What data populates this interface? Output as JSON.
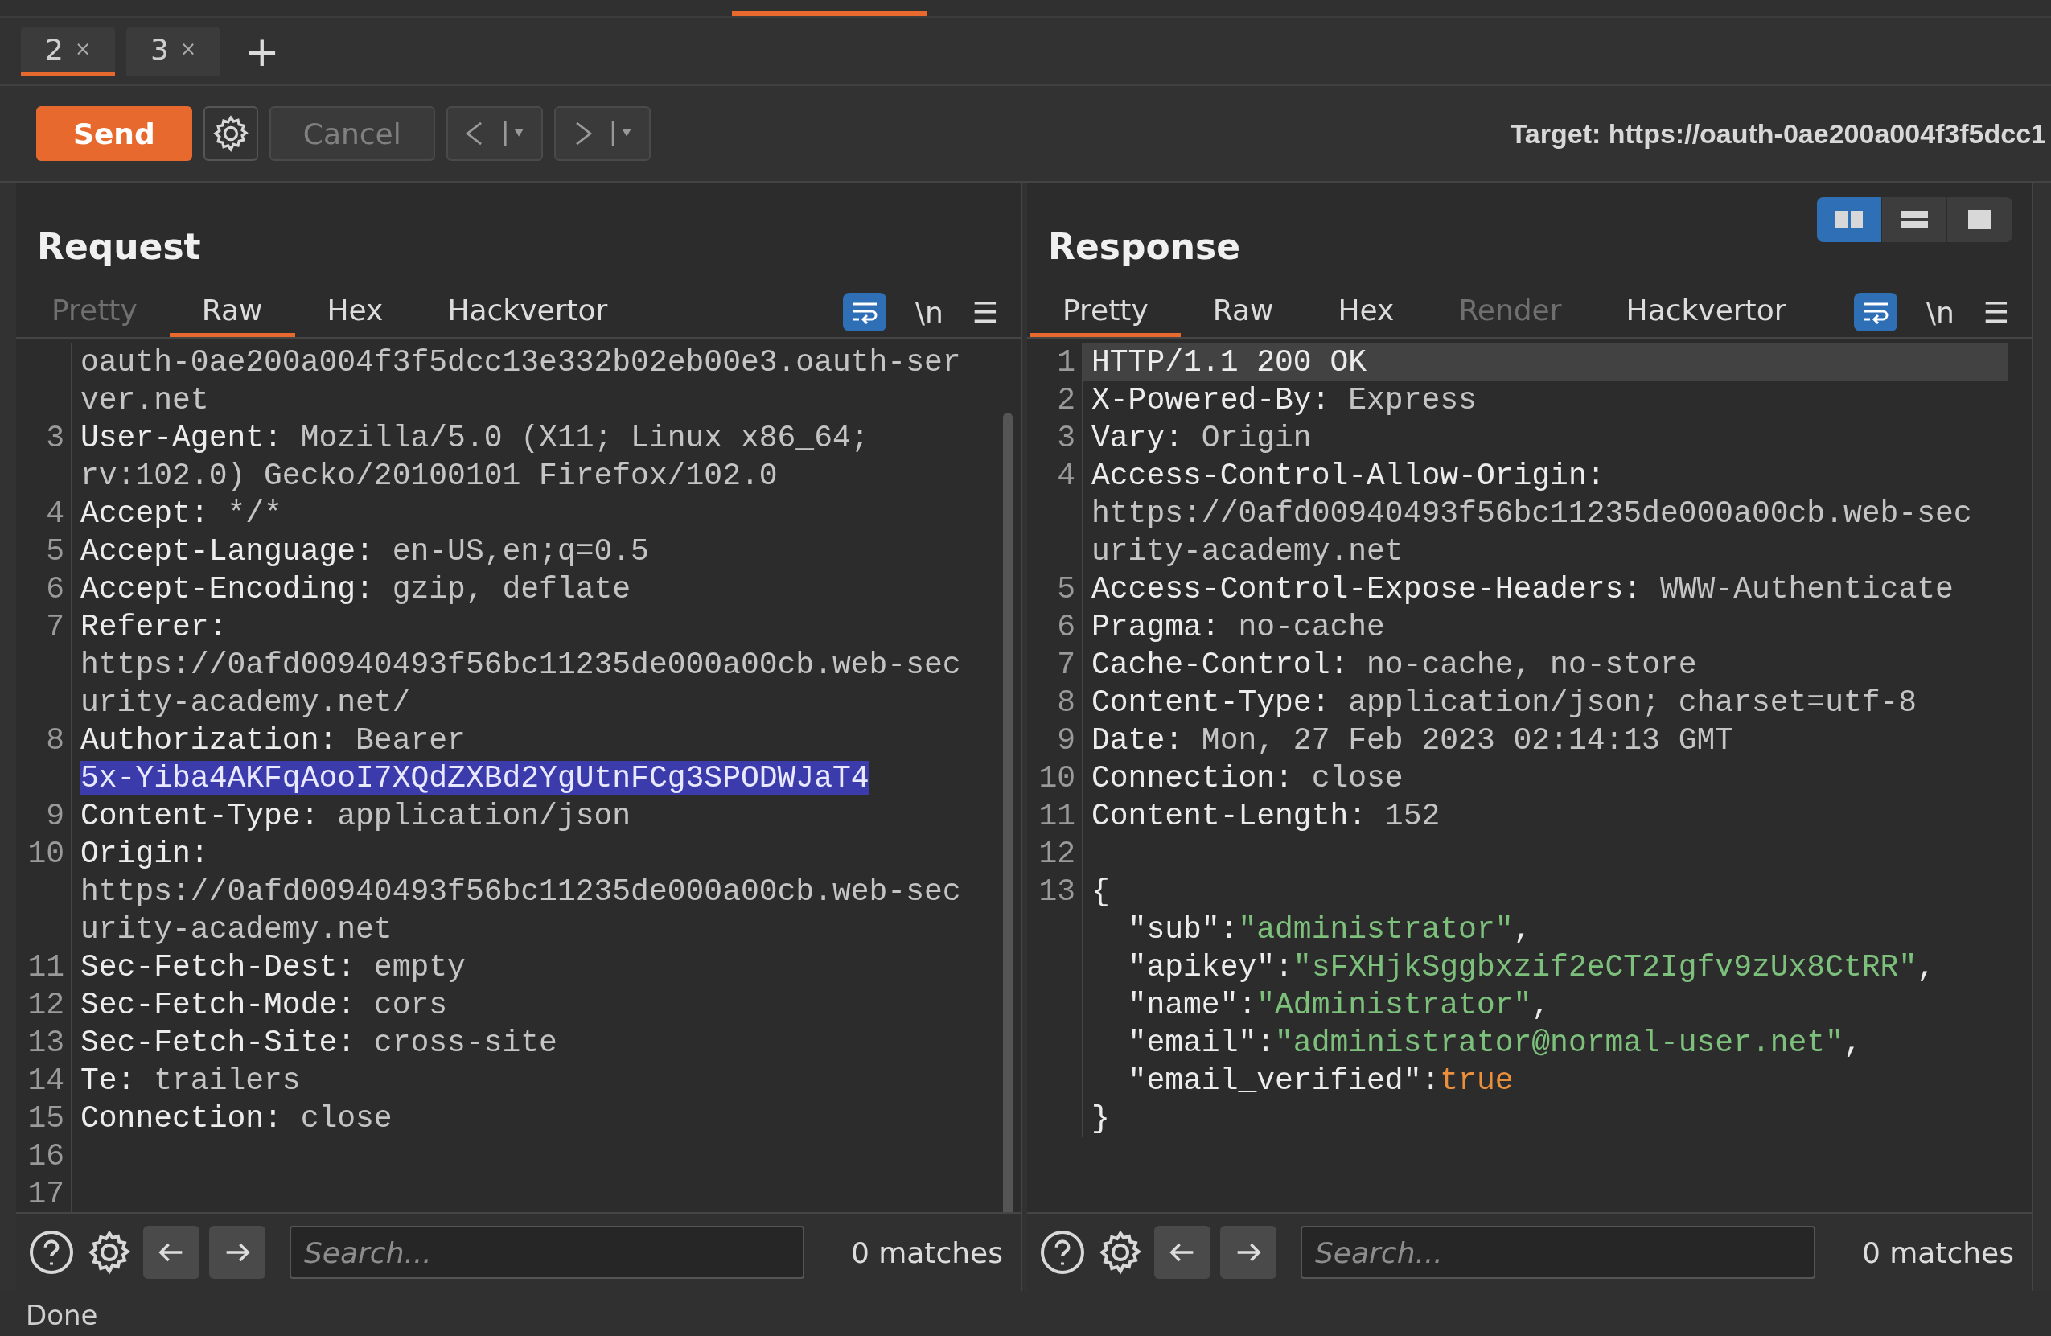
{
  "tabs": [
    {
      "label": "2",
      "close": "×",
      "selected": true
    },
    {
      "label": "3",
      "close": "×",
      "selected": false
    }
  ],
  "new_tab": "+",
  "toolbar": {
    "send": "Send",
    "cancel": {
      "label": "Cancel",
      "disabled": true
    },
    "target": "Target: https://oauth-0ae200a004f3f5dcc1"
  },
  "request": {
    "title": "Request",
    "tabs": [
      {
        "label": "Pretty",
        "selected": false,
        "disabled": true
      },
      {
        "label": "Raw",
        "selected": true,
        "disabled": false
      },
      {
        "label": "Hex",
        "selected": false,
        "disabled": false
      },
      {
        "label": "Hackvertor",
        "selected": false,
        "disabled": false
      }
    ],
    "wrap_on": true,
    "newline_label": "\\n",
    "menu_glyph": "☰",
    "rows": [
      {
        "current": false,
        "segments": [
          {
            "kind": "value",
            "text": "oauth-0ae200a004f3f5dcc13e332b02eb00e3.oauth-ser"
          }
        ]
      },
      {
        "current": false,
        "segments": [
          {
            "kind": "value",
            "text": "ver.net"
          }
        ]
      },
      {
        "number": "3",
        "current": false,
        "segments": [
          {
            "kind": "name",
            "text": "User-Agent:"
          },
          {
            "kind": "value",
            "text": " Mozilla/5.0 (X11; Linux x86_64;"
          }
        ]
      },
      {
        "current": false,
        "segments": [
          {
            "kind": "value",
            "text": "rv:102.0) Gecko/20100101 Firefox/102.0"
          }
        ]
      },
      {
        "number": "4",
        "current": false,
        "segments": [
          {
            "kind": "name",
            "text": "Accept:"
          },
          {
            "kind": "value",
            "text": " */*"
          }
        ]
      },
      {
        "number": "5",
        "current": false,
        "segments": [
          {
            "kind": "name",
            "text": "Accept-Language:"
          },
          {
            "kind": "value",
            "text": " en-US,en;q=0.5"
          }
        ]
      },
      {
        "number": "6",
        "current": false,
        "segments": [
          {
            "kind": "name",
            "text": "Accept-Encoding:"
          },
          {
            "kind": "value",
            "text": " gzip, deflate"
          }
        ]
      },
      {
        "number": "7",
        "current": false,
        "segments": [
          {
            "kind": "name",
            "text": "Referer:"
          }
        ]
      },
      {
        "current": false,
        "segments": [
          {
            "kind": "value",
            "text": "https://0afd00940493f56bc11235de000a00cb.web-sec"
          }
        ]
      },
      {
        "current": false,
        "segments": [
          {
            "kind": "value",
            "text": "urity-academy.net/"
          }
        ]
      },
      {
        "number": "8",
        "current": false,
        "segments": [
          {
            "kind": "name",
            "text": "Authorization:"
          },
          {
            "kind": "value",
            "text": " Bearer"
          }
        ]
      },
      {
        "current": false,
        "segments": [
          {
            "kind": "selected",
            "text": "5x-Yiba4AKFqAooI7XQdZXBd2YgUtnFCg3SPODWJaT4"
          }
        ]
      },
      {
        "number": "9",
        "current": false,
        "segments": [
          {
            "kind": "name",
            "text": "Content-Type:"
          },
          {
            "kind": "value",
            "text": " application/json"
          }
        ]
      },
      {
        "number": "10",
        "current": false,
        "segments": [
          {
            "kind": "name",
            "text": "Origin:"
          }
        ]
      },
      {
        "current": false,
        "segments": [
          {
            "kind": "value",
            "text": "https://0afd00940493f56bc11235de000a00cb.web-sec"
          }
        ]
      },
      {
        "current": false,
        "segments": [
          {
            "kind": "value",
            "text": "urity-academy.net"
          }
        ]
      },
      {
        "number": "11",
        "current": false,
        "segments": [
          {
            "kind": "name",
            "text": "Sec-Fetch-Dest:"
          },
          {
            "kind": "value",
            "text": " empty"
          }
        ]
      },
      {
        "number": "12",
        "current": false,
        "segments": [
          {
            "kind": "name",
            "text": "Sec-Fetch-Mode:"
          },
          {
            "kind": "value",
            "text": " cors"
          }
        ]
      },
      {
        "number": "13",
        "current": false,
        "segments": [
          {
            "kind": "name",
            "text": "Sec-Fetch-Site:"
          },
          {
            "kind": "value",
            "text": " cross-site"
          }
        ]
      },
      {
        "number": "14",
        "current": false,
        "segments": [
          {
            "kind": "name",
            "text": "Te:"
          },
          {
            "kind": "value",
            "text": " trailers"
          }
        ]
      },
      {
        "number": "15",
        "current": false,
        "segments": [
          {
            "kind": "name",
            "text": "Connection:"
          },
          {
            "kind": "value",
            "text": " close"
          }
        ]
      },
      {
        "number": "16",
        "current": false
      },
      {
        "number": "17",
        "current": false
      }
    ],
    "search": {
      "placeholder": "Search..."
    },
    "matches": "0 matches"
  },
  "response": {
    "title": "Response",
    "layouts": [
      {
        "kind": "columns",
        "selected": true
      },
      {
        "kind": "rows",
        "selected": false
      },
      {
        "kind": "single",
        "selected": false
      }
    ],
    "tabs": [
      {
        "label": "Pretty",
        "selected": true,
        "disabled": false
      },
      {
        "label": "Raw",
        "selected": false,
        "disabled": false
      },
      {
        "label": "Hex",
        "selected": false,
        "disabled": false
      },
      {
        "label": "Render",
        "selected": false,
        "disabled": true
      },
      {
        "label": "Hackvertor",
        "selected": false,
        "disabled": false
      }
    ],
    "wrap_on": true,
    "newline_label": "\\n",
    "menu_glyph": "☰",
    "rows": [
      {
        "number": "1",
        "current": true,
        "segments": [
          {
            "kind": "name",
            "text": "HTTP/1.1 200 OK"
          }
        ]
      },
      {
        "number": "2",
        "current": false,
        "segments": [
          {
            "kind": "name",
            "text": "X-Powered-By:"
          },
          {
            "kind": "value",
            "text": " Express"
          }
        ]
      },
      {
        "number": "3",
        "current": false,
        "segments": [
          {
            "kind": "name",
            "text": "Vary:"
          },
          {
            "kind": "value",
            "text": " Origin"
          }
        ]
      },
      {
        "number": "4",
        "current": false,
        "segments": [
          {
            "kind": "name",
            "text": "Access-Control-Allow-Origin:"
          }
        ]
      },
      {
        "current": false,
        "segments": [
          {
            "kind": "value",
            "text": "https://0afd00940493f56bc11235de000a00cb.web-sec"
          }
        ]
      },
      {
        "current": false,
        "segments": [
          {
            "kind": "value",
            "text": "urity-academy.net"
          }
        ]
      },
      {
        "number": "5",
        "current": false,
        "segments": [
          {
            "kind": "name",
            "text": "Access-Control-Expose-Headers:"
          },
          {
            "kind": "value",
            "text": " WWW-Authenticate"
          }
        ]
      },
      {
        "number": "6",
        "current": false,
        "segments": [
          {
            "kind": "name",
            "text": "Pragma:"
          },
          {
            "kind": "value",
            "text": " no-cache"
          }
        ]
      },
      {
        "number": "7",
        "current": false,
        "segments": [
          {
            "kind": "name",
            "text": "Cache-Control:"
          },
          {
            "kind": "value",
            "text": " no-cache, no-store"
          }
        ]
      },
      {
        "number": "8",
        "current": false,
        "segments": [
          {
            "kind": "name",
            "text": "Content-Type:"
          },
          {
            "kind": "value",
            "text": " application/json; charset=utf-8"
          }
        ]
      },
      {
        "number": "9",
        "current": false,
        "segments": [
          {
            "kind": "name",
            "text": "Date:"
          },
          {
            "kind": "value",
            "text": " Mon, 27 Feb 2023 02:14:13 GMT"
          }
        ]
      },
      {
        "number": "10",
        "current": false,
        "segments": [
          {
            "kind": "name",
            "text": "Connection:"
          },
          {
            "kind": "value",
            "text": " close"
          }
        ]
      },
      {
        "number": "11",
        "current": false,
        "segments": [
          {
            "kind": "name",
            "text": "Content-Length:"
          },
          {
            "kind": "value",
            "text": " 152"
          }
        ]
      },
      {
        "number": "12",
        "current": false
      },
      {
        "number": "13",
        "current": false,
        "segments": [
          {
            "kind": "punct",
            "text": "{"
          }
        ]
      },
      {
        "current": false,
        "segments": [
          {
            "kind": "key",
            "text": "  \"sub\""
          },
          {
            "kind": "punct",
            "text": ":"
          },
          {
            "kind": "string",
            "text": "\"administrator\""
          },
          {
            "kind": "punct",
            "text": ","
          }
        ]
      },
      {
        "current": false,
        "segments": [
          {
            "kind": "key",
            "text": "  \"apikey\""
          },
          {
            "kind": "punct",
            "text": ":"
          },
          {
            "kind": "string",
            "text": "\"sFXHjkSggbxzif2eCT2Igfv9zUx8CtRR\""
          },
          {
            "kind": "punct",
            "text": ","
          }
        ]
      },
      {
        "current": false,
        "segments": [
          {
            "kind": "key",
            "text": "  \"name\""
          },
          {
            "kind": "punct",
            "text": ":"
          },
          {
            "kind": "string",
            "text": "\"Administrator\""
          },
          {
            "kind": "punct",
            "text": ","
          }
        ]
      },
      {
        "current": false,
        "segments": [
          {
            "kind": "key",
            "text": "  \"email\""
          },
          {
            "kind": "punct",
            "text": ":"
          },
          {
            "kind": "string",
            "text": "\"administrator@normal-user.net\""
          },
          {
            "kind": "punct",
            "text": ","
          }
        ]
      },
      {
        "current": false,
        "segments": [
          {
            "kind": "key",
            "text": "  \"email_verified\""
          },
          {
            "kind": "punct",
            "text": ":"
          },
          {
            "kind": "literal",
            "text": "true"
          }
        ]
      },
      {
        "current": false,
        "segments": [
          {
            "kind": "punct",
            "text": "}"
          }
        ]
      }
    ],
    "search": {
      "placeholder": "Search..."
    },
    "matches": "0 matches"
  },
  "status_bar": "Done"
}
